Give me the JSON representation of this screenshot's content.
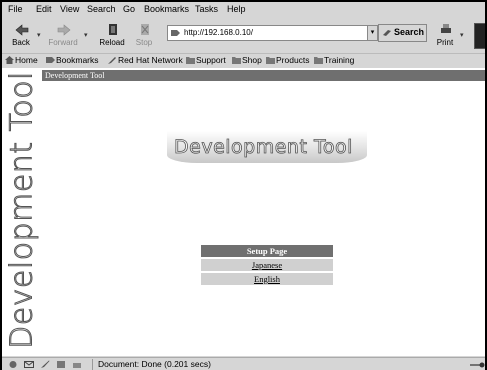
{
  "menu": [
    "File",
    "Edit",
    "View",
    "Search",
    "Go",
    "Bookmarks",
    "Tasks",
    "Help"
  ],
  "toolbar": {
    "back": "Back",
    "forward": "Forward",
    "reload": "Reload",
    "stop": "Stop",
    "url": "http://192.168.0.10/",
    "search": "Search",
    "print": "Print"
  },
  "personal_toolbar": [
    "Home",
    "Bookmarks",
    "Red Hat Network",
    "Support",
    "Shop",
    "Products",
    "Training"
  ],
  "page": {
    "titlebar": "Development Tool",
    "side_title": "Development Tool",
    "banner": "Development Tool",
    "setup_heading": "Setup Page",
    "links": [
      "Japanese",
      "English"
    ]
  },
  "status": {
    "message": "Document: Done (0.201 secs)"
  }
}
